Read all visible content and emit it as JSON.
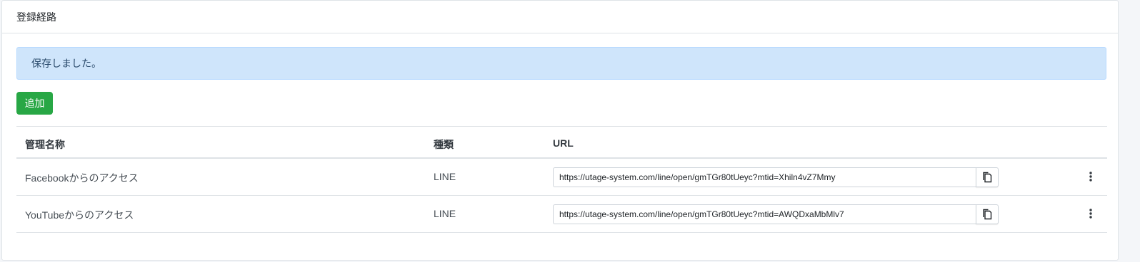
{
  "card": {
    "title": "登録経路"
  },
  "alert": {
    "message": "保存しました。"
  },
  "toolbar": {
    "add_label": "追加"
  },
  "table": {
    "headers": {
      "name": "管理名称",
      "type": "種類",
      "url": "URL"
    },
    "rows": [
      {
        "name": "Facebookからのアクセス",
        "type": "LINE",
        "url": "https://utage-system.com/line/open/gmTGr80tUeyc?mtid=Xhiln4vZ7Mmy"
      },
      {
        "name": "YouTubeからのアクセス",
        "type": "LINE",
        "url": "https://utage-system.com/line/open/gmTGr80tUeyc?mtid=AWQDxaMbMlv7"
      }
    ]
  },
  "icons": {
    "copy": "copy-icon",
    "more": "vertical-ellipsis-icon"
  },
  "colors": {
    "success": "#28a745",
    "info_bg": "#cfe5fb",
    "info_text": "#2a4a6b"
  }
}
